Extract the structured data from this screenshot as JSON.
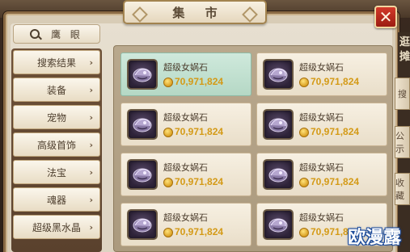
{
  "window": {
    "title": "集 市",
    "close_icon": "close-x-icon"
  },
  "sidebar": {
    "search_label": "鹰 眼",
    "search_icon": "magnifier-icon",
    "items": [
      {
        "label": "搜索结果",
        "chevron": "›"
      },
      {
        "label": "装备",
        "chevron": "›"
      },
      {
        "label": "宠物",
        "chevron": "›"
      },
      {
        "label": "高级首饰",
        "chevron": "›"
      },
      {
        "label": "法宝",
        "chevron": "›"
      },
      {
        "label": "魂器",
        "chevron": "›"
      },
      {
        "label": "超级黑水晶",
        "chevron": "›"
      }
    ]
  },
  "market": {
    "listings": [
      {
        "name": "超级女娲石",
        "price": "70,971,824",
        "selected": true
      },
      {
        "name": "超级女娲石",
        "price": "70,971,824",
        "selected": false
      },
      {
        "name": "超级女娲石",
        "price": "70,971,824",
        "selected": false
      },
      {
        "name": "超级女娲石",
        "price": "70,971,824",
        "selected": false
      },
      {
        "name": "超级女娲石",
        "price": "70,971,824",
        "selected": false
      },
      {
        "name": "超级女娲石",
        "price": "70,971,824",
        "selected": false
      },
      {
        "name": "超级女娲石",
        "price": "70,971,824",
        "selected": false
      },
      {
        "name": "超级女娲石",
        "price": "70,971,824",
        "selected": false
      }
    ]
  },
  "right_panel": {
    "top_label": "逛摊",
    "tabs": [
      "搜",
      "公示",
      "收藏"
    ]
  },
  "watermark": "欧漫露",
  "colors": {
    "price": "#d49a16",
    "selected_card": "#cfe9dc",
    "close_button": "#c0281b"
  }
}
